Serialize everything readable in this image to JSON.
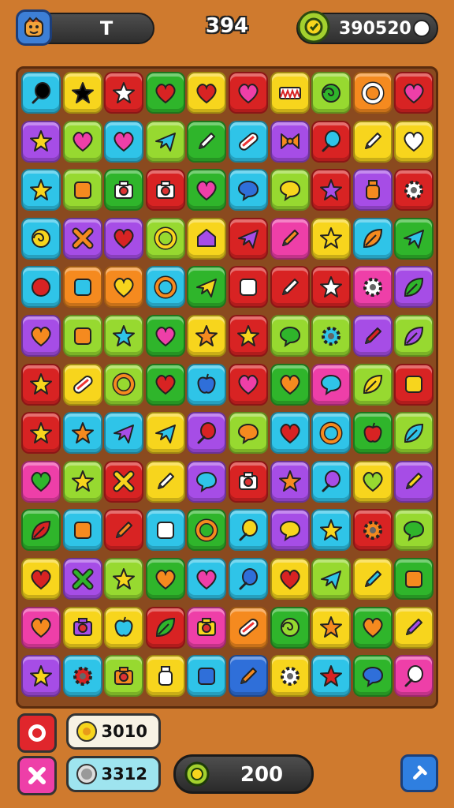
{
  "header": {
    "player_initial": "T",
    "center_score": "394",
    "coins": "390520",
    "icons": [
      "avatar-icon",
      "coin-icon",
      "clock-icon"
    ]
  },
  "board": {
    "columns": 10,
    "rows": 13,
    "tiles": [
      [
        [
          "c",
          "ic",
          "balloon"
        ],
        [
          "y",
          "ic",
          "star"
        ],
        [
          "r",
          "w",
          "star"
        ],
        [
          "g",
          "r",
          "heart"
        ],
        [
          "y",
          "r",
          "heart"
        ],
        [
          "r",
          "pk",
          "heart"
        ],
        [
          "y",
          "r",
          "zigzag"
        ],
        [
          "l",
          "g",
          "swirl"
        ],
        [
          "o",
          "w",
          "ring"
        ],
        [
          "r",
          "pk",
          "heart"
        ]
      ],
      [
        [
          "p",
          "y",
          "star"
        ],
        [
          "l",
          "pk",
          "heart"
        ],
        [
          "c",
          "pk",
          "heart"
        ],
        [
          "l",
          "c",
          "plane"
        ],
        [
          "g",
          "w",
          "pencil"
        ],
        [
          "c",
          "w",
          "pill"
        ],
        [
          "p",
          "o",
          "bow"
        ],
        [
          "r",
          "c",
          "balloon"
        ],
        [
          "y",
          "w",
          "pencil"
        ],
        [
          "y",
          "w",
          "heart"
        ]
      ],
      [
        [
          "c",
          "y",
          "star"
        ],
        [
          "l",
          "o",
          "square"
        ],
        [
          "g",
          "w",
          "camera"
        ],
        [
          "r",
          "w",
          "camera"
        ],
        [
          "g",
          "pk",
          "heart"
        ],
        [
          "c",
          "b",
          "bubble"
        ],
        [
          "l",
          "y",
          "bubble"
        ],
        [
          "r",
          "p",
          "star"
        ],
        [
          "p",
          "o",
          "jar"
        ],
        [
          "r",
          "w",
          "gear"
        ]
      ],
      [
        [
          "c",
          "y",
          "swirl"
        ],
        [
          "p",
          "o",
          "x"
        ],
        [
          "p",
          "r",
          "heart"
        ],
        [
          "l",
          "y",
          "ring"
        ],
        [
          "y",
          "p",
          "house"
        ],
        [
          "r",
          "p",
          "plane"
        ],
        [
          "pk",
          "o",
          "pencil"
        ],
        [
          "y",
          "y",
          "star"
        ],
        [
          "c",
          "o",
          "leaf"
        ],
        [
          "g",
          "c",
          "plane"
        ]
      ],
      [
        [
          "c",
          "r",
          "dot"
        ],
        [
          "o",
          "c",
          "square"
        ],
        [
          "o",
          "y",
          "heart"
        ],
        [
          "c",
          "o",
          "ring"
        ],
        [
          "g",
          "y",
          "plane"
        ],
        [
          "r",
          "w",
          "square"
        ],
        [
          "r",
          "w",
          "pencil"
        ],
        [
          "r",
          "w",
          "star"
        ],
        [
          "pk",
          "w",
          "gear"
        ],
        [
          "p",
          "g",
          "leaf"
        ]
      ],
      [
        [
          "p",
          "o",
          "heart"
        ],
        [
          "l",
          "o",
          "square"
        ],
        [
          "l",
          "c",
          "star"
        ],
        [
          "g",
          "pk",
          "heart"
        ],
        [
          "y",
          "o",
          "star"
        ],
        [
          "r",
          "y",
          "star"
        ],
        [
          "l",
          "g",
          "bubble"
        ],
        [
          "l",
          "c",
          "gear"
        ],
        [
          "p",
          "r",
          "pencil"
        ],
        [
          "l",
          "p",
          "leaf"
        ]
      ],
      [
        [
          "r",
          "y",
          "star"
        ],
        [
          "y",
          "w",
          "pill"
        ],
        [
          "l",
          "o",
          "ring"
        ],
        [
          "g",
          "r",
          "heart"
        ],
        [
          "c",
          "b",
          "apple"
        ],
        [
          "r",
          "pk",
          "heart"
        ],
        [
          "g",
          "o",
          "heart"
        ],
        [
          "pk",
          "c",
          "bubble"
        ],
        [
          "l",
          "y",
          "leaf"
        ],
        [
          "r",
          "y",
          "square"
        ]
      ],
      [
        [
          "r",
          "y",
          "star"
        ],
        [
          "c",
          "o",
          "star"
        ],
        [
          "c",
          "p",
          "plane"
        ],
        [
          "y",
          "c",
          "plane"
        ],
        [
          "p",
          "r",
          "balloon"
        ],
        [
          "l",
          "o",
          "bubble"
        ],
        [
          "c",
          "r",
          "heart"
        ],
        [
          "c",
          "o",
          "ring"
        ],
        [
          "g",
          "r",
          "apple"
        ],
        [
          "l",
          "c",
          "leaf"
        ]
      ],
      [
        [
          "pk",
          "g",
          "heart"
        ],
        [
          "l",
          "y",
          "star"
        ],
        [
          "r",
          "y",
          "x"
        ],
        [
          "y",
          "w",
          "pencil"
        ],
        [
          "p",
          "c",
          "bubble"
        ],
        [
          "r",
          "w",
          "camera"
        ],
        [
          "p",
          "o",
          "star"
        ],
        [
          "c",
          "p",
          "balloon"
        ],
        [
          "y",
          "l",
          "heart"
        ],
        [
          "p",
          "y",
          "pencil"
        ]
      ],
      [
        [
          "g",
          "r",
          "leaf"
        ],
        [
          "c",
          "o",
          "square"
        ],
        [
          "r",
          "o",
          "pencil"
        ],
        [
          "c",
          "w",
          "square"
        ],
        [
          "g",
          "o",
          "ring"
        ],
        [
          "c",
          "y",
          "balloon"
        ],
        [
          "p",
          "y",
          "bubble"
        ],
        [
          "c",
          "y",
          "star"
        ],
        [
          "r",
          "o",
          "gear"
        ],
        [
          "l",
          "g",
          "bubble"
        ]
      ],
      [
        [
          "y",
          "r",
          "heart"
        ],
        [
          "p",
          "g",
          "x"
        ],
        [
          "l",
          "y",
          "star"
        ],
        [
          "g",
          "o",
          "heart"
        ],
        [
          "c",
          "pk",
          "heart"
        ],
        [
          "c",
          "b",
          "balloon"
        ],
        [
          "y",
          "r",
          "heart"
        ],
        [
          "l",
          "c",
          "plane"
        ],
        [
          "y",
          "c",
          "pencil"
        ],
        [
          "g",
          "o",
          "square"
        ]
      ],
      [
        [
          "pk",
          "o",
          "heart"
        ],
        [
          "y",
          "p",
          "camera"
        ],
        [
          "y",
          "c",
          "apple"
        ],
        [
          "r",
          "g",
          "leaf"
        ],
        [
          "pk",
          "y",
          "camera"
        ],
        [
          "o",
          "w",
          "pill"
        ],
        [
          "g",
          "l",
          "swirl"
        ],
        [
          "y",
          "o",
          "star"
        ],
        [
          "g",
          "o",
          "heart"
        ],
        [
          "y",
          "p",
          "pencil"
        ]
      ],
      [
        [
          "p",
          "y",
          "star"
        ],
        [
          "c",
          "r",
          "gear"
        ],
        [
          "l",
          "o",
          "camera"
        ],
        [
          "y",
          "w",
          "jar"
        ],
        [
          "c",
          "b",
          "square"
        ],
        [
          "b",
          "o",
          "pencil"
        ],
        [
          "y",
          "w",
          "gear"
        ],
        [
          "c",
          "r",
          "star"
        ],
        [
          "g",
          "b",
          "bubble"
        ],
        [
          "pk",
          "w",
          "balloon"
        ]
      ]
    ]
  },
  "bottom_bar": {
    "counter_top": "3010",
    "counter_bottom": "3312",
    "moves": "200",
    "icons": [
      "target-icon",
      "shuffle-icon",
      "coin-icon",
      "timer-icon",
      "hammer-icon"
    ]
  },
  "palette": {
    "c": "#2fc4e8",
    "y": "#f7d51d",
    "r": "#d82323",
    "g": "#2fb52b",
    "l": "#97d930",
    "p": "#a64de6",
    "o": "#f58a1f",
    "pk": "#ee3fa8",
    "b": "#2f6fd9",
    "w": "#ffffff"
  }
}
